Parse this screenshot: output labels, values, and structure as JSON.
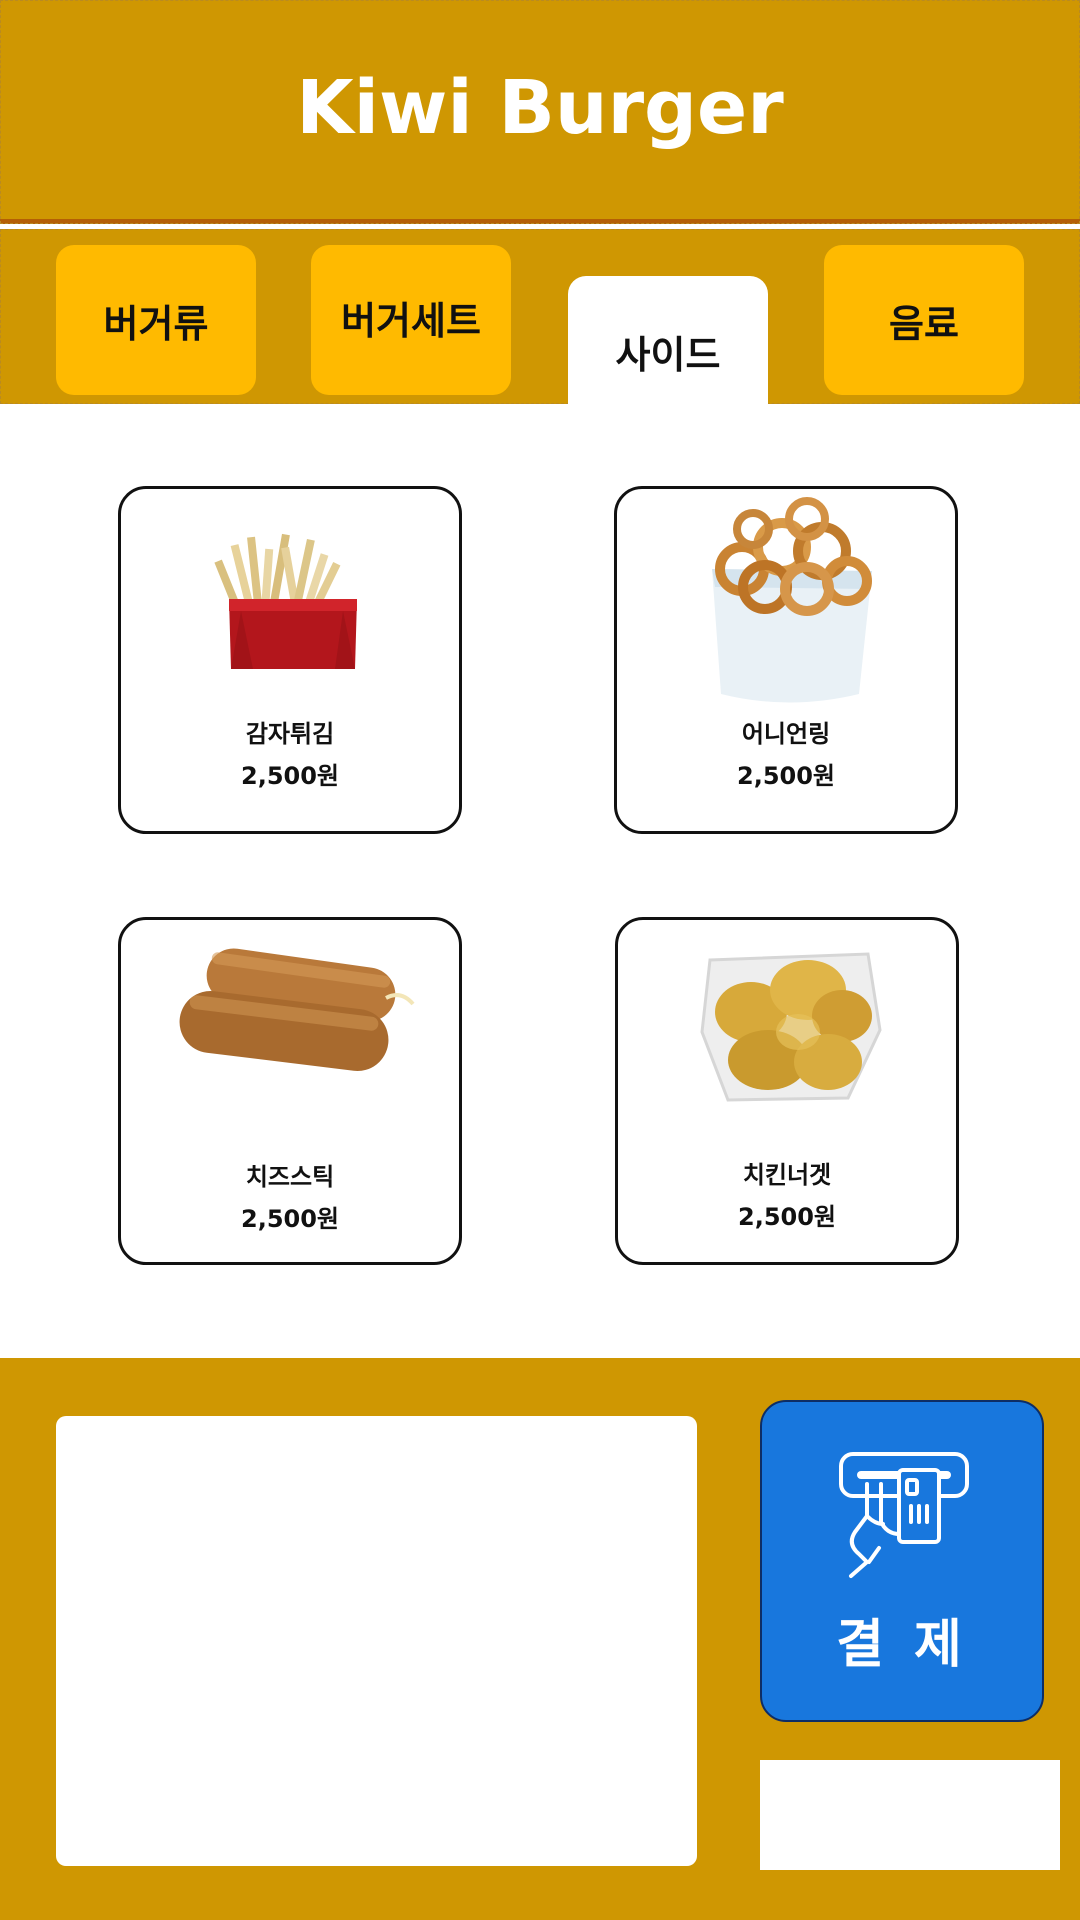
{
  "app": {
    "title": "Kiwi Burger"
  },
  "tabs": [
    {
      "label": "버거류",
      "active": false
    },
    {
      "label": "버거세트",
      "active": false
    },
    {
      "label": "사이드",
      "active": true
    },
    {
      "label": "음료",
      "active": false
    }
  ],
  "menu": {
    "items": [
      {
        "name": "감자튀김",
        "price": "2,500원",
        "icon": "french-fries-image"
      },
      {
        "name": "어니언링",
        "price": "2,500원",
        "icon": "onion-rings-image"
      },
      {
        "name": "치즈스틱",
        "price": "2,500원",
        "icon": "cheese-sticks-image"
      },
      {
        "name": "치킨너겟",
        "price": "2,500원",
        "icon": "chicken-nuggets-image"
      }
    ]
  },
  "checkout": {
    "pay_label": "결 제",
    "pay_icon": "card-payment-icon"
  },
  "colors": {
    "brand": "#cf9702",
    "tab": "#ffba00",
    "tab_active": "#ffffff",
    "pay": "#1877dd",
    "divider": "#b45f06"
  }
}
